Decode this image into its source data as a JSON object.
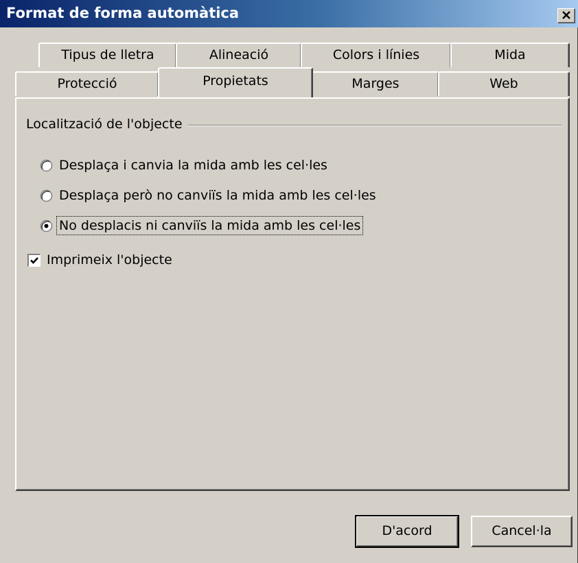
{
  "window": {
    "title": "Format de forma automàtica",
    "close_icon": "close-icon"
  },
  "tabs": {
    "row_back": [
      "Tipus de lletra",
      "Alineació",
      "Colors i línies",
      "Mida"
    ],
    "row_front": [
      "Protecció",
      "Propietats",
      "Marges",
      "Web"
    ],
    "active": "Propietats"
  },
  "panel": {
    "group_label": "Localització de l'objecte",
    "radios": [
      {
        "label": "Desplaça i canvia la mida amb les cel·les",
        "selected": false
      },
      {
        "label": "Desplaça però no canviïs la mida amb les cel·les",
        "selected": false
      },
      {
        "label": "No desplacis ni canviïs la mida amb les cel·les",
        "selected": true
      }
    ],
    "print_checkbox": {
      "label": "Imprimeix l'objecte",
      "checked": true
    }
  },
  "buttons": {
    "ok": "D'acord",
    "cancel": "Cancel·la"
  }
}
